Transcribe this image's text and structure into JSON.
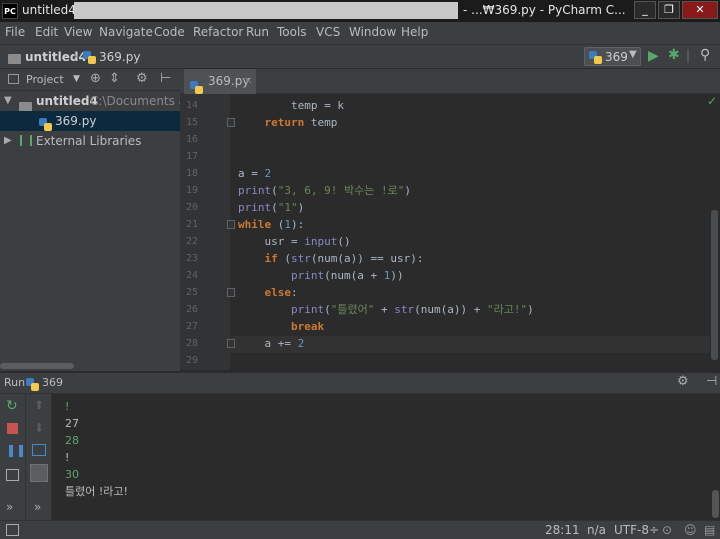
{
  "titlebar": {
    "logo": "PC",
    "project": "untitled4",
    "title": "- ...₩369.py - PyCharm C...",
    "buttons": [
      "_",
      "❐",
      "✕"
    ]
  },
  "menu": [
    {
      "label": "File"
    },
    {
      "label": "Edit"
    },
    {
      "label": "View"
    },
    {
      "label": "Navigate"
    },
    {
      "label": "Code"
    },
    {
      "label": "Refactor"
    },
    {
      "label": "Run"
    },
    {
      "label": "Tools"
    },
    {
      "label": "VCS"
    },
    {
      "label": "Window"
    },
    {
      "label": "Help"
    }
  ],
  "navbar": {
    "crumb_project": "untitled4",
    "crumb_file": "369.py",
    "run_config": "369"
  },
  "project_panel": {
    "title": "Project",
    "items": [
      {
        "label": "untitled4",
        "path": "C:\\Documents and"
      },
      {
        "label": "369.py"
      },
      {
        "label": "External Libraries"
      }
    ]
  },
  "editor": {
    "tab": "369.py",
    "line_numbers": [
      "14",
      "15",
      "16",
      "17",
      "18",
      "19",
      "20",
      "21",
      "22",
      "23",
      "24",
      "25",
      "26",
      "27",
      "28",
      "29"
    ]
  },
  "run_panel": {
    "label": "Run",
    "config": "369"
  },
  "console": {
    "lines": [
      {
        "text": "!",
        "type": "input"
      },
      {
        "text": "27",
        "type": "output"
      },
      {
        "text": "28",
        "type": "input"
      },
      {
        "text": "!",
        "type": "output"
      },
      {
        "text": "30",
        "type": "input"
      },
      {
        "text": "틀렸어 !라고!",
        "type": "output"
      }
    ]
  },
  "statusbar": {
    "position": "28:11",
    "line_sep": "n/a",
    "encoding": "UTF-8÷"
  },
  "colors": {
    "background": "#2b2b2b",
    "panel": "#3c3f41",
    "keyword": "#cc7832",
    "string": "#6a8759",
    "number": "#6897bb",
    "run_green": "#59a869",
    "stop_red": "#c75450"
  }
}
